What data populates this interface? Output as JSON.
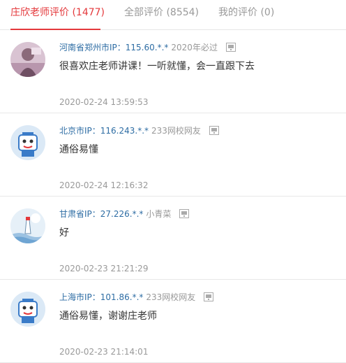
{
  "tabs": [
    {
      "label": "庄欣老师评价 (1477)",
      "active": true
    },
    {
      "label": "全部评价 (8554)",
      "active": false
    },
    {
      "label": "我的评价 (0)",
      "active": false
    }
  ],
  "colors": {
    "accent": "#e4393c",
    "location": "#2e6da4",
    "muted": "#999999"
  },
  "comments": [
    {
      "location": "河南省郑州市IP：115.60.*.*",
      "user": "2020年必过",
      "content": "很喜欢庄老师讲课！一听就懂，会一直跟下去",
      "time": "2020-02-24 13:59:53",
      "avatar": "photo-avatar"
    },
    {
      "location": "北京市IP：116.243.*.*",
      "user": "233网校网友",
      "content": "通俗易懂",
      "time": "2020-02-24 12:16:32",
      "avatar": "robot-avatar"
    },
    {
      "location": "甘肃省IP：27.226.*.*",
      "user": "小青菜",
      "content": "好",
      "time": "2020-02-23 21:21:29",
      "avatar": "lighthouse-avatar"
    },
    {
      "location": "上海市IP：101.86.*.*",
      "user": "233网校网友",
      "content": "通俗易懂，谢谢庄老师",
      "time": "2020-02-23 21:14:01",
      "avatar": "robot-avatar"
    }
  ]
}
